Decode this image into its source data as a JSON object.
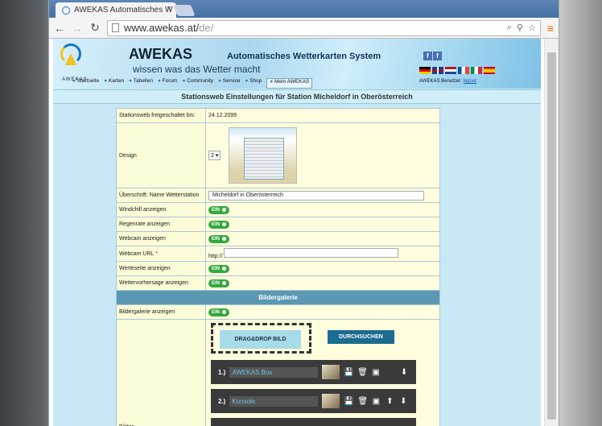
{
  "browser": {
    "tab_title": "AWEKAS Automatisches W",
    "tab_close": "×",
    "url_host": "www.awekas.at/",
    "url_path": "de/"
  },
  "header": {
    "logo_text": "AWEKAS",
    "brand": "AWEKAS",
    "brand_sub": "Automatisches Wetterkarten System",
    "slogan": "wissen was das Wetter macht",
    "user_label": "AWEKAS Benutzer:",
    "logout": "logout",
    "nav": [
      "Startseite",
      "Karten",
      "Tabellen",
      "Forum",
      "Community",
      "Service",
      "Shop",
      "Mein AWEKAS"
    ]
  },
  "page_title": "Stationsweb Einstellungen für Station Micheldorf in Oberösterreich",
  "settings": {
    "freigeschaltet_label": "Stationsweb freigeschaltet bis:",
    "freigeschaltet_value": "24.12.2099",
    "design_label": "Design",
    "design_value": "2",
    "ueberschrift_label": "Überschrift: Name Wetterstation",
    "ueberschrift_value": "Micheldorf in Oberösterreich",
    "windchill_label": "Windchill anzeigen",
    "regenrate_label": "Regenrate anzeigen",
    "webcam_label": "Webcam anzeigen",
    "webcam_url_label": "Webcam URL",
    "webcam_url_required": "*",
    "webcam_url_prefix": "http://",
    "werteseite_label": "Werteseite anzeigen",
    "vorhersage_label": "Wettervorhersage anzeigen",
    "toggle_on": "EIN",
    "section_bildergalerie": "Bildergalerie",
    "bildergalerie_label": "Bildergalerie anzeigen",
    "bilder_label": "Bilder",
    "dnd_label": "DRAG&DROP BILD",
    "browse_label": "DURCHSUCHEN"
  },
  "gallery": [
    {
      "num": "1.)",
      "name": "AWEKAS Box"
    },
    {
      "num": "2.)",
      "name": "Konsole"
    }
  ],
  "colors": {
    "toggle": "#33a83d",
    "section": "#5b98b4",
    "browse": "#1b6c8f"
  }
}
